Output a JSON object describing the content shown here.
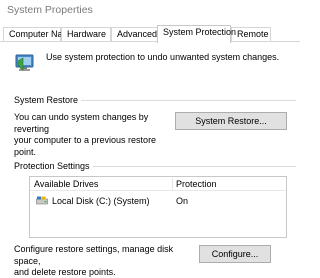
{
  "window": {
    "title": "System Properties"
  },
  "tabs": [
    {
      "label": "Computer Name",
      "active": false
    },
    {
      "label": "Hardware",
      "active": false
    },
    {
      "label": "Advanced",
      "active": false
    },
    {
      "label": "System Protection",
      "active": true
    },
    {
      "label": "Remote",
      "active": false
    }
  ],
  "intro": {
    "icon": "shield-computer-icon",
    "text": "Use system protection to undo unwanted system changes."
  },
  "system_restore": {
    "group_label": "System Restore",
    "description_line1": "You can undo system changes by reverting",
    "description_line2": "your computer to a previous restore point.",
    "button_label": "System Restore..."
  },
  "protection_settings": {
    "group_label": "Protection Settings",
    "columns": [
      "Available Drives",
      "Protection"
    ],
    "rows": [
      {
        "drive": "Local Disk (C:) (System)",
        "protection": "On",
        "icon": "local-disk-icon"
      }
    ],
    "config_line1": "Configure restore settings, manage disk space,",
    "config_line2": "and delete restore points.",
    "configure_label": "Configure..."
  },
  "colors": {
    "button_bg": "#e1e1e1",
    "border": "#adadad",
    "title_text": "#7a7a7a"
  }
}
